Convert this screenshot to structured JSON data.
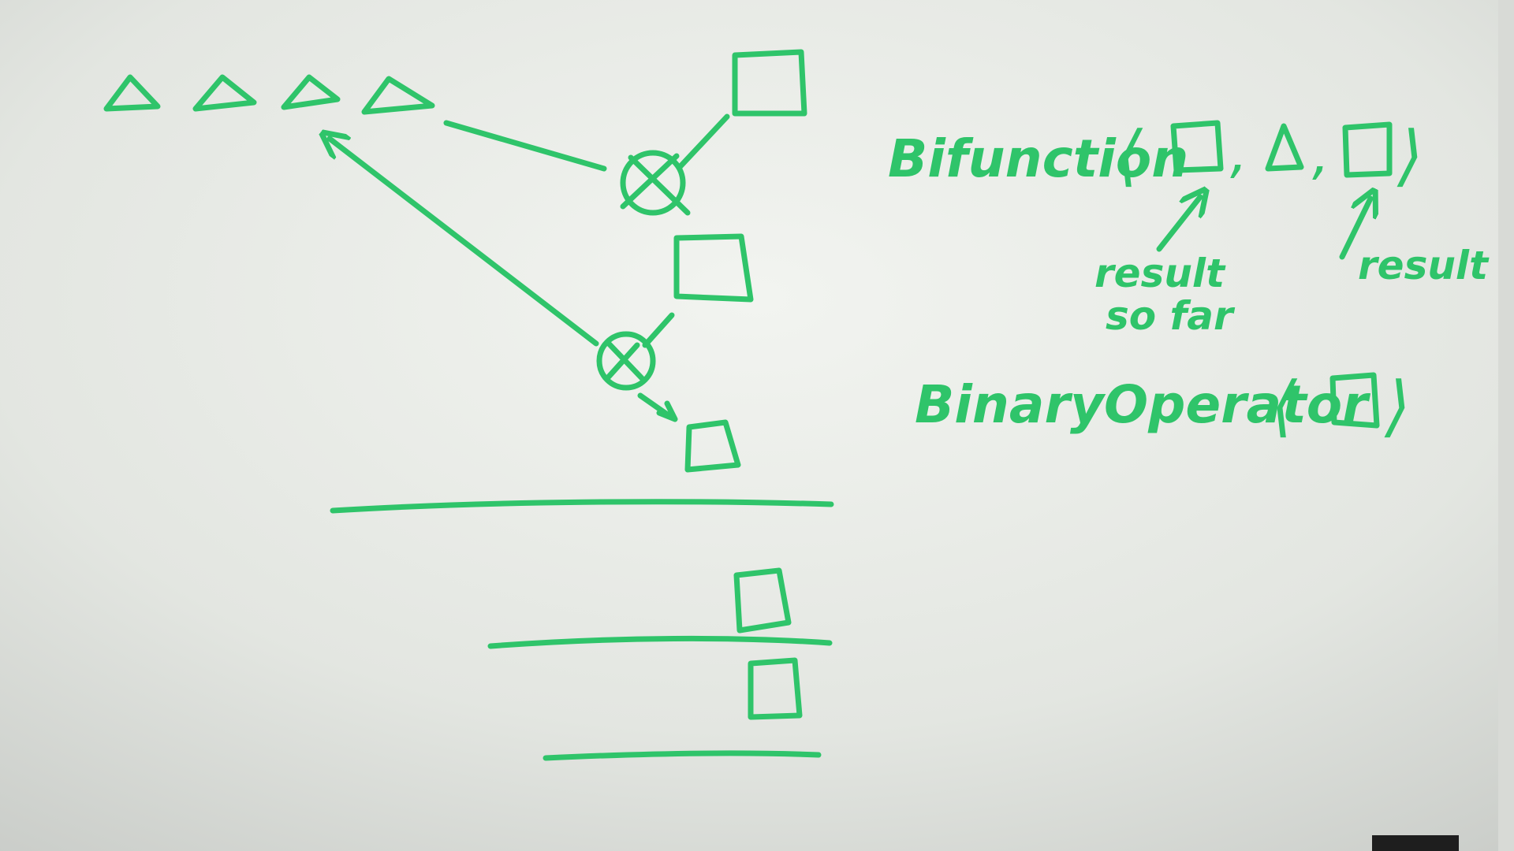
{
  "colors": {
    "ink": "#2fc46a",
    "board_light": "#eef0ec",
    "board_dark": "#c9ccc8",
    "frame": "#1e1e1e"
  },
  "whiteboard": {
    "notation": {
      "bifunction_name": "Bifunction",
      "bifunction_open": "⟨",
      "bifunction_close": "⟩",
      "comma_1": ",",
      "comma_2": ",",
      "result_so_far_line1": "result",
      "result_so_far_line2": "so far",
      "result_label": "result",
      "binary_operator_name": "BinaryOperator",
      "binary_operator_open": "⟨",
      "binary_operator_close": "⟩"
    },
    "shapes": {
      "triangle_count": 4,
      "square_icon": "square-shape",
      "triangle_icon": "triangle-shape",
      "operator_icon": "circled-times-operator"
    }
  }
}
